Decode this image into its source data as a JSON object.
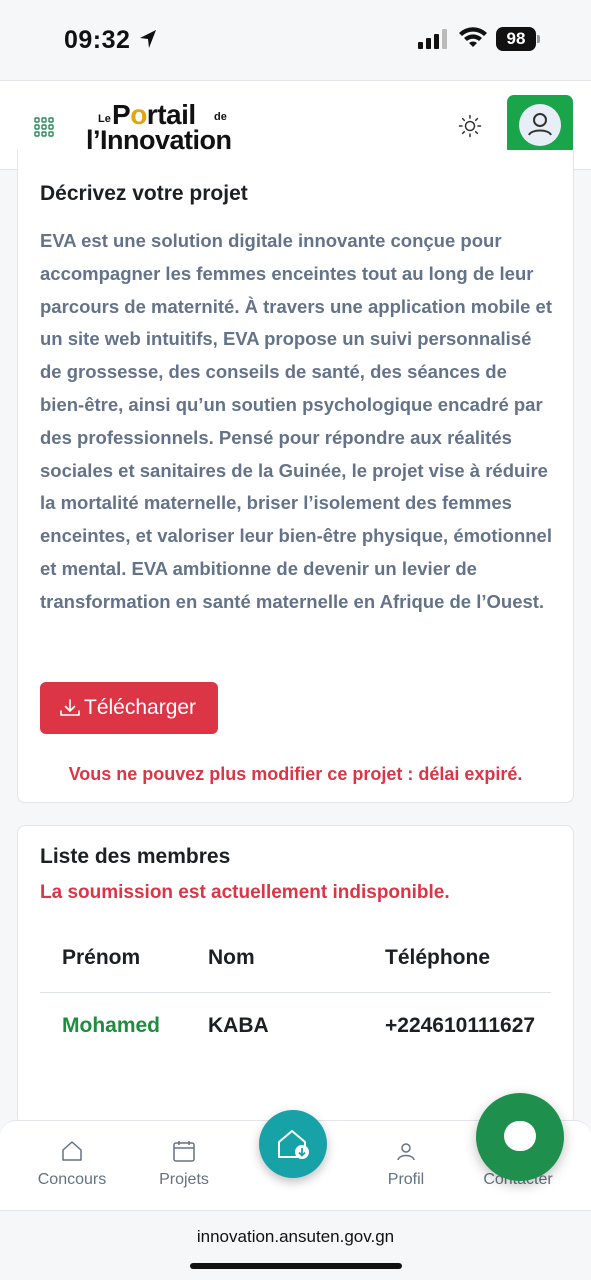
{
  "status_bar": {
    "time": "09:32",
    "battery": "98"
  },
  "header": {
    "logo_le": "Le",
    "logo_portail_pre": "P",
    "logo_portail_bulb": "o",
    "logo_portail_post": "rtail",
    "logo_de": "de",
    "logo_innovation": "l’Innovation"
  },
  "project": {
    "title": "Décrivez votre projet",
    "description": "EVA est une solution digitale innovante conçue pour accompagner les femmes enceintes tout au long de leur parcours de maternité. À travers une application mobile et un site web intuitifs, EVA propose un suivi personnalisé de grossesse, des conseils de santé, des séances de bien-être, ainsi qu’un soutien psychologique encadré par des professionnels. Pensé pour répondre aux réalités sociales et sanitaires de la Guinée, le projet vise à réduire la mortalité maternelle, briser l’isolement des femmes enceintes, et valoriser leur bien-être physique, émotionnel et mental. EVA ambitionne de devenir un levier de transformation en santé maternelle en Afrique de l’Ouest.",
    "download_label": "Télécharger",
    "warning": "Vous ne pouvez plus modifier ce projet : délai expiré."
  },
  "members": {
    "title": "Liste des membres",
    "unavailable": "La soumission est actuellement indisponible.",
    "columns": [
      "Prénom",
      "Nom",
      "Téléphone"
    ],
    "rows": [
      {
        "prenom": "Mohamed",
        "nom": "KABA",
        "telephone": "+224610111627"
      }
    ]
  },
  "bottom_nav": {
    "items": [
      {
        "label": "Concours",
        "icon": "home-outline-icon"
      },
      {
        "label": "Projets",
        "icon": "calendar-icon"
      },
      {
        "label": "",
        "icon": "home-download-icon"
      },
      {
        "label": "Profil",
        "icon": "person-icon"
      },
      {
        "label": "Contacter",
        "icon": "chat-icon"
      }
    ]
  },
  "browser": {
    "url": "innovation.ansuten.gov.gn"
  },
  "colors": {
    "accent_green": "#1aa54a",
    "danger": "#dc3545",
    "teal": "#17a2a8",
    "text_muted": "#647389"
  }
}
